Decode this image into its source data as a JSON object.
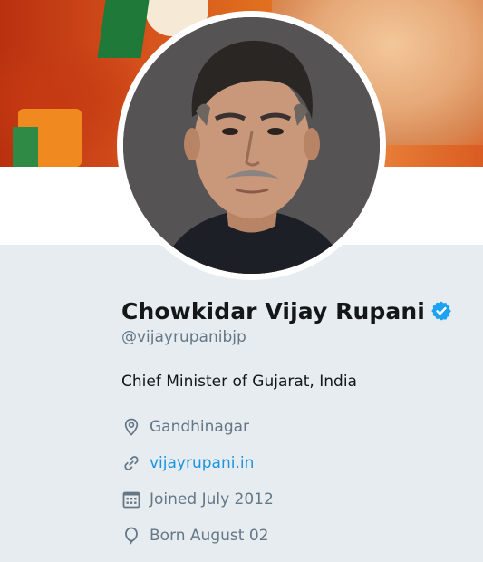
{
  "profile": {
    "display_name": "Chowkidar Vijay Rupani",
    "handle": "@vijayrupanibjp",
    "bio": "Chief Minister of Gujarat, India",
    "verified": true,
    "location": "Gandhinagar",
    "website": "vijayrupani.in",
    "joined": "Joined July 2012",
    "birthday": "Born August 02"
  },
  "icons": {
    "verified": "verified-badge-icon",
    "location": "location-pin-icon",
    "website": "link-icon",
    "joined": "calendar-icon",
    "birthday": "balloon-icon"
  },
  "colors": {
    "background": "#e6ecf0",
    "text": "#14171a",
    "secondary_text": "#657786",
    "link": "#1b95e0",
    "verified": "#1da1f2"
  }
}
